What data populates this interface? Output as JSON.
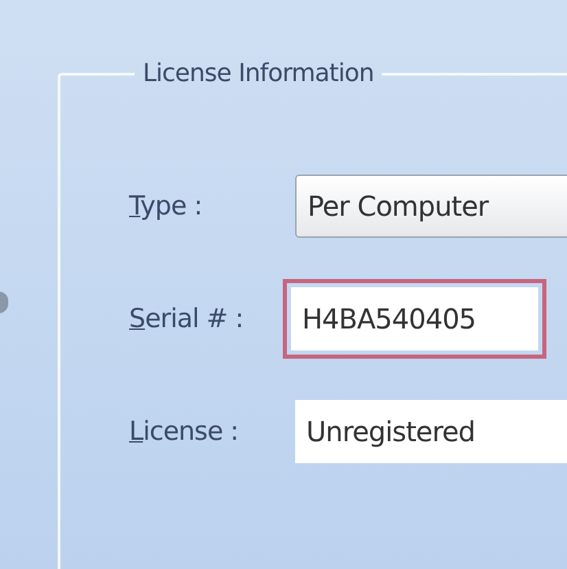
{
  "group": {
    "title": "License Information"
  },
  "fields": [
    {
      "kind": "dropdown",
      "label": "Type :",
      "accelerator_underlined": true,
      "value": "Per Computer",
      "highlighted": false
    },
    {
      "kind": "text",
      "label": "Serial # :",
      "accelerator_underlined": true,
      "value": "H4BA540405",
      "highlighted": true
    },
    {
      "kind": "text",
      "label": "License :",
      "accelerator_underlined": true,
      "value": "Unregistered",
      "highlighted": false
    }
  ]
}
